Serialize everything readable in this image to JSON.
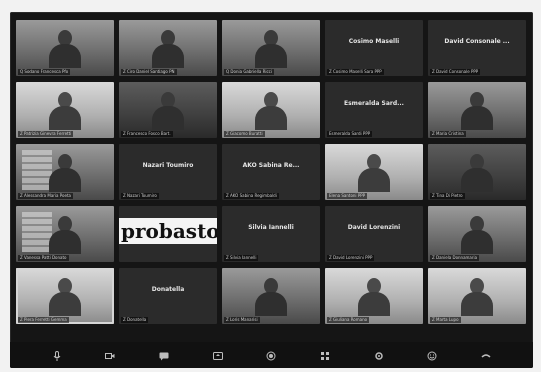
{
  "participants": [
    {
      "display_name": "",
      "nameplate": "Q Sodano Francesca Pfo",
      "kind": "video",
      "tone": "normal"
    },
    {
      "display_name": "",
      "nameplate": "Z Ciro Daniel Santiago PN",
      "kind": "video",
      "tone": "normal"
    },
    {
      "display_name": "",
      "nameplate": "Q Donia Gabriella Ricci",
      "kind": "video",
      "tone": "normal"
    },
    {
      "display_name": "Cosimo Maselli",
      "nameplate": "Z Cosimo Maselli Sara PPP",
      "kind": "name",
      "tone": ""
    },
    {
      "display_name": "David Consonale ...",
      "nameplate": "Z David Consonale PPP",
      "kind": "name",
      "tone": ""
    },
    {
      "display_name": "",
      "nameplate": "Z Patrizia Ginevra Ferretti",
      "kind": "video",
      "tone": "light"
    },
    {
      "display_name": "",
      "nameplate": "Z Francesco Fosco Bart.",
      "kind": "video",
      "tone": "dark"
    },
    {
      "display_name": "",
      "nameplate": "Z Giacomo Buratti",
      "kind": "video",
      "tone": "light"
    },
    {
      "display_name": "Esmeralda Sard...",
      "nameplate": "Esmeralda Sardi PPP",
      "kind": "name",
      "tone": ""
    },
    {
      "display_name": "",
      "nameplate": "Z Maria Cristina",
      "kind": "video",
      "tone": "normal"
    },
    {
      "display_name": "",
      "nameplate": "Z Alessandra Maria Poeta",
      "kind": "video",
      "tone": "normal"
    },
    {
      "display_name": "Nazari Toumiro",
      "nameplate": "Z Nazari Toumiro",
      "kind": "name",
      "tone": ""
    },
    {
      "display_name": "AKO Sabina Re...",
      "nameplate": "Z AKO Sabina Regimbaldi",
      "kind": "name",
      "tone": ""
    },
    {
      "display_name": "",
      "nameplate": "Elena Santoni PPP",
      "kind": "video",
      "tone": "light"
    },
    {
      "display_name": "",
      "nameplate": "Z Tina Di Pietro",
      "kind": "video",
      "tone": "dark"
    },
    {
      "display_name": "",
      "nameplate": "Z Vanessa Patti Donato",
      "kind": "video",
      "tone": "normal"
    },
    {
      "display_name": "",
      "nameplate": "",
      "kind": "banner",
      "banner_text": "probasto",
      "tone": ""
    },
    {
      "display_name": "Silvia Iannelli",
      "nameplate": "Z Silvia Iannelli",
      "kind": "name",
      "tone": ""
    },
    {
      "display_name": "David Lorenzini",
      "nameplate": "Z David Lorenzini PPP",
      "kind": "name",
      "tone": ""
    },
    {
      "display_name": "",
      "nameplate": "Z Daniela Donnamaria",
      "kind": "video",
      "tone": "normal"
    },
    {
      "display_name": "",
      "nameplate": "Z Piera Ferretti Gemma",
      "kind": "video",
      "tone": "light"
    },
    {
      "display_name": "Donatella",
      "nameplate": "Z Donatella",
      "kind": "name",
      "tone": ""
    },
    {
      "display_name": "",
      "nameplate": "Z Loris Manarisi",
      "kind": "video",
      "tone": "normal"
    },
    {
      "display_name": "",
      "nameplate": "Z Giuliana Romano",
      "kind": "video",
      "tone": "light"
    },
    {
      "display_name": "",
      "nameplate": "Z Marta Lupo",
      "kind": "video",
      "tone": "light"
    }
  ],
  "toolbar": {
    "buttons": [
      {
        "icon": "microphone-icon"
      },
      {
        "icon": "video-camera-icon"
      },
      {
        "icon": "chat-icon"
      },
      {
        "icon": "share-screen-icon"
      },
      {
        "icon": "record-icon"
      },
      {
        "icon": "participants-icon"
      },
      {
        "icon": "settings-icon"
      },
      {
        "icon": "reactions-icon"
      },
      {
        "icon": "leave-icon"
      }
    ]
  },
  "colors": {
    "window_bg": "#151515",
    "tile_bg": "#2b2b2b",
    "toolbar_bg": "#111111",
    "icon": "#bdbdbd"
  }
}
